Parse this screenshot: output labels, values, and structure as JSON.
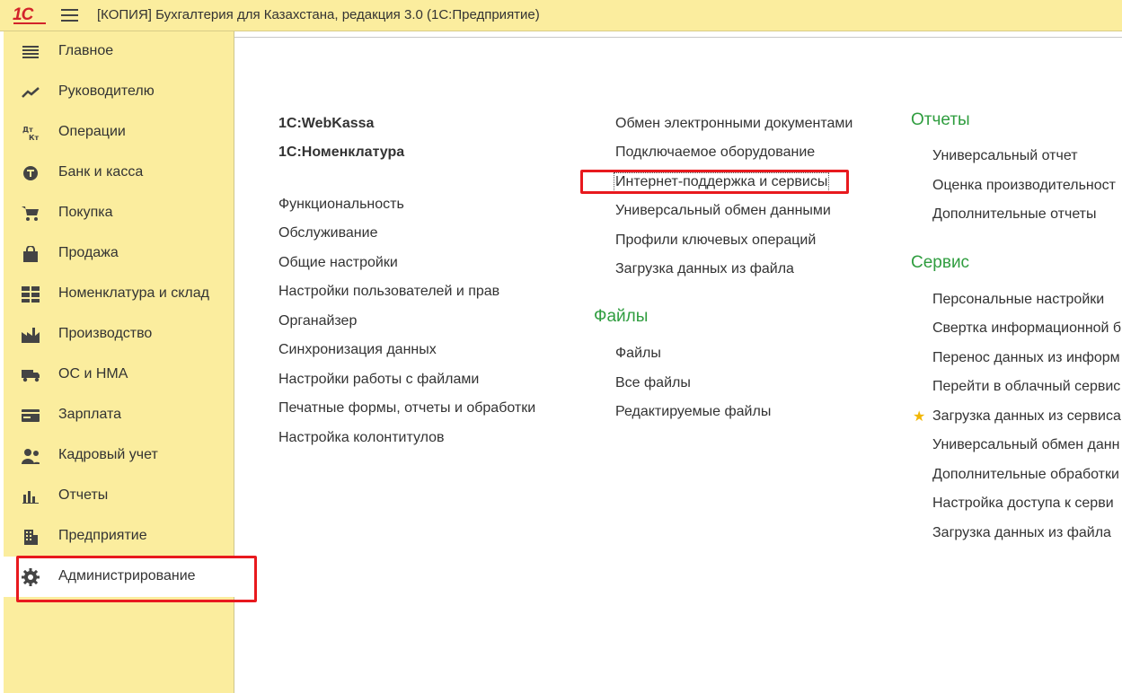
{
  "app": {
    "logo_text": "1С",
    "title": "[КОПИЯ] Бухгалтерия для Казахстана, редакция 3.0  (1С:Предприятие)"
  },
  "sidebar": {
    "items": [
      {
        "label": "Главное",
        "icon": "list-icon"
      },
      {
        "label": "Руководителю",
        "icon": "trend-icon"
      },
      {
        "label": "Операции",
        "icon": "debit-credit-icon"
      },
      {
        "label": "Банк и касса",
        "icon": "coin-icon"
      },
      {
        "label": "Покупка",
        "icon": "cart-icon"
      },
      {
        "label": "Продажа",
        "icon": "bag-icon"
      },
      {
        "label": "Номенклатура и склад",
        "icon": "grid-icon"
      },
      {
        "label": "Производство",
        "icon": "factory-icon"
      },
      {
        "label": "ОС и НМА",
        "icon": "truck-icon"
      },
      {
        "label": "Зарплата",
        "icon": "card-icon"
      },
      {
        "label": "Кадровый учет",
        "icon": "people-icon"
      },
      {
        "label": "Отчеты",
        "icon": "bar-chart-icon"
      },
      {
        "label": "Предприятие",
        "icon": "building-icon"
      },
      {
        "label": "Администрирование",
        "icon": "gear-icon",
        "active": true
      }
    ]
  },
  "col1": {
    "bold_links": [
      "1С:WebKassa",
      "1С:Номенклатура"
    ],
    "links": [
      "Функциональность",
      "Обслуживание",
      "Общие настройки",
      "Настройки пользователей и прав",
      "Органайзер",
      "Синхронизация данных",
      "Настройки работы с файлами",
      "Печатные формы, отчеты и обработки",
      "Настройка колонтитулов"
    ]
  },
  "col2": {
    "links": [
      "Обмен электронными документами",
      "Подключаемое оборудование",
      "Интернет-поддержка и сервисы",
      "Универсальный обмен данными",
      "Профили ключевых операций",
      "Загрузка данных из файла"
    ],
    "files_group": {
      "title": "Файлы",
      "links": [
        "Файлы",
        "Все файлы",
        "Редактируемые файлы"
      ]
    }
  },
  "col3": {
    "reports_group": {
      "title": "Отчеты",
      "links": [
        "Универсальный отчет",
        "Оценка производительност",
        "Дополнительные отчеты"
      ]
    },
    "service_group": {
      "title": "Сервис",
      "links": [
        "Персональные настройки",
        "Свертка информационной б",
        "Перенос данных из информ",
        "Перейти в облачный сервис",
        "Загрузка данных из сервиса",
        "Универсальный обмен данн",
        "Дополнительные обработки",
        "Настройка доступа к серви",
        "Загрузка данных из файла"
      ]
    }
  },
  "colors": {
    "sidebar_bg": "#fbed9e",
    "group_title": "#2f9d3f",
    "highlight": "#e8191e",
    "favorite_star": "#f2b705"
  }
}
